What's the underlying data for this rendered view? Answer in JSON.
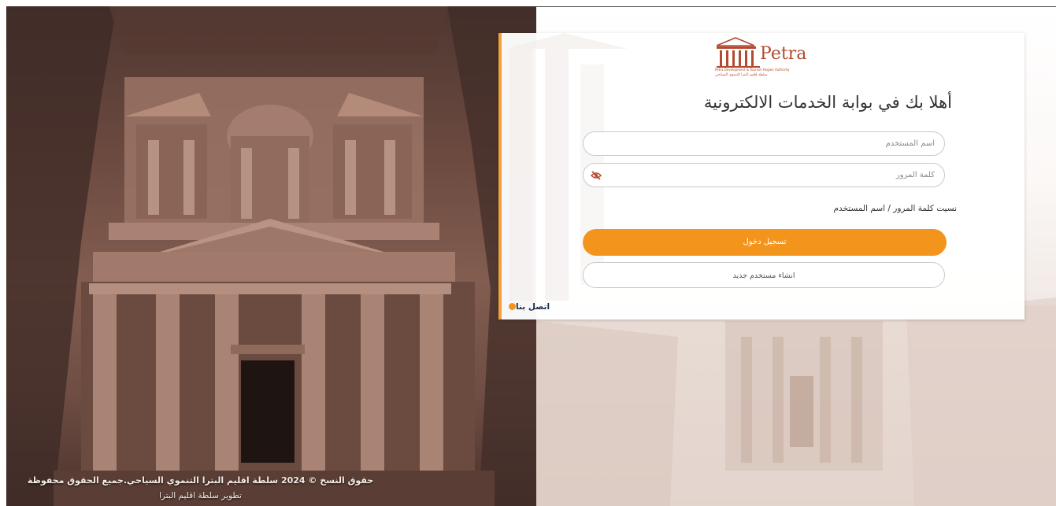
{
  "footer": {
    "copyright": "حقوق النسخ © 2024 سلطة اقليم البترا التنموي السياحي.جميع الحقوق محفوظة",
    "developed_by": "تطوير سلطة اقليم البترا"
  },
  "logo": {
    "wordmark": "Petra",
    "subtitle_en": "Petra Development & Tourism Region Authority",
    "subtitle_ar": "سلطة إقليم البترا التنموي السياحي"
  },
  "login": {
    "welcome": "أهلا بك في بوابة الخدمات الالكترونية",
    "username_placeholder": "اسم المستخدم",
    "password_placeholder": "كلمة المرور",
    "forgot_link": "نسيت كلمة المرور / اسم المستخدم",
    "login_button": "تسجيل دخول",
    "register_button": "انشاء مستخدم جديد",
    "contact_link": "اتصل بنا"
  },
  "colors": {
    "accent": "#f3951d",
    "brand": "#b5492f"
  },
  "icons": {
    "password_toggle": "eye-slash-icon",
    "contact": "circle-icon"
  }
}
